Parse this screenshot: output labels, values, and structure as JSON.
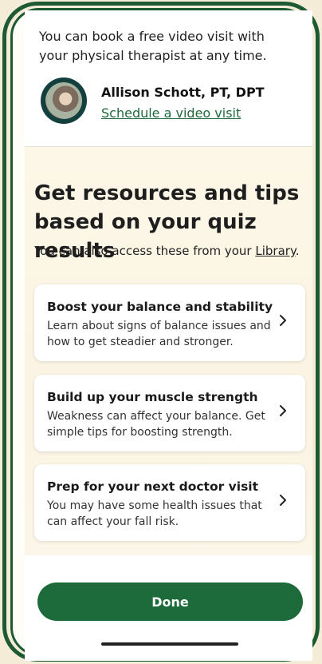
{
  "intro": {
    "text": "You can book a free video visit with your physical therapist at any time."
  },
  "therapist": {
    "name": "Allison Schott, PT, DPT",
    "link_label": "Schedule a video visit"
  },
  "resources": {
    "heading": "Get resources and tips based on your quiz results",
    "subtext_prefix": "You can also access these from your ",
    "subtext_link": "Library",
    "subtext_suffix": ".",
    "cards": [
      {
        "title": "Boost your balance and stability",
        "description": "Learn about signs of balance issues and how to get steadier and stronger."
      },
      {
        "title": "Build up your muscle strength",
        "description": "Weakness can affect your balance. Get simple tips for boosting strength."
      },
      {
        "title": "Prep for your next doctor visit",
        "description": "You may have some health issues that can affect your fall risk."
      }
    ]
  },
  "footer": {
    "done_label": "Done"
  },
  "colors": {
    "brand_green": "#1d6a3a",
    "frame_green": "#1d5a34",
    "background_cream": "#f4ecd6"
  }
}
